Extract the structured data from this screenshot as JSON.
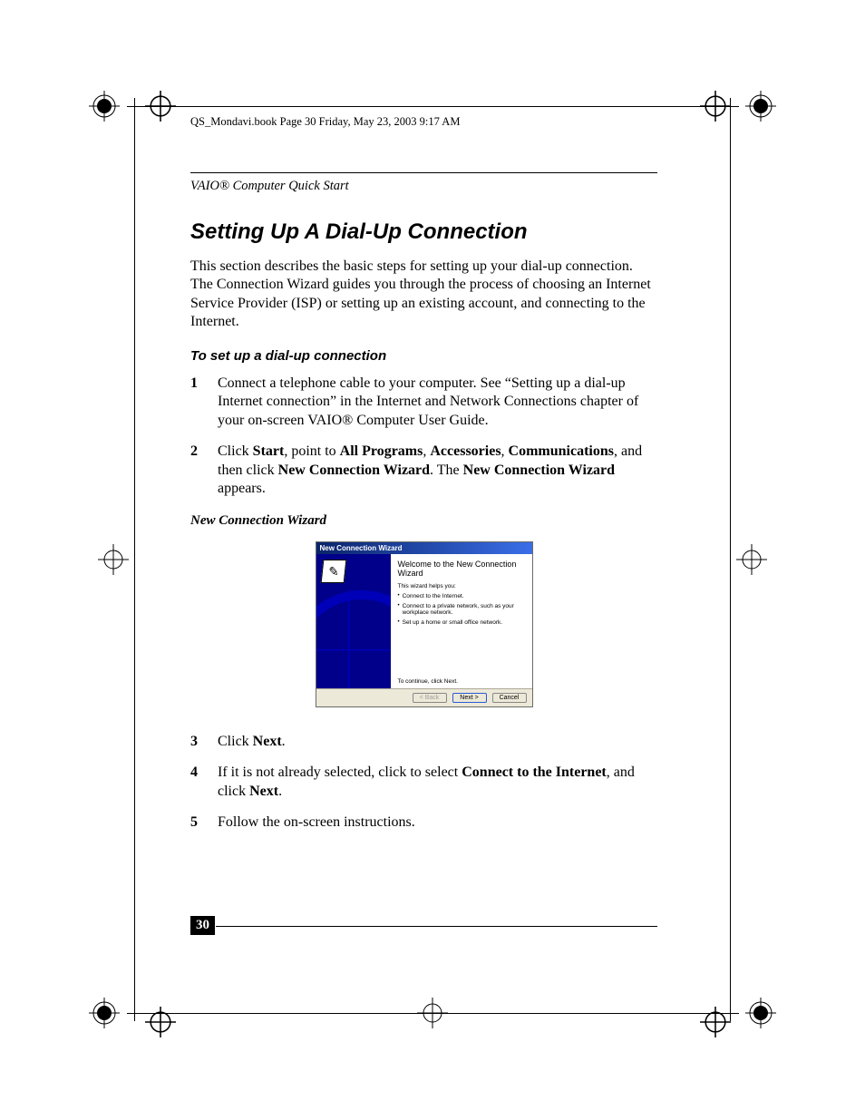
{
  "header_line": "QS_Mondavi.book  Page 30  Friday, May 23, 2003  9:17 AM",
  "running_head": "VAIO® Computer Quick Start",
  "section_title": "Setting Up A Dial-Up Connection",
  "intro_para": "This section describes the basic steps for setting up your dial-up connection. The Connection Wizard guides you through the process of choosing an Internet Service Provider (ISP) or setting up an existing account, and connecting to the Internet.",
  "sub_title": "To set up a dial-up connection",
  "steps": {
    "s1": {
      "num": "1",
      "text_a": "Connect a telephone cable to your computer. See “Setting up a dial-up Internet connection” in the Internet and Network Connections chapter of your on-screen VAIO® Computer User Guide."
    },
    "s2": {
      "num": "2",
      "t1": "Click ",
      "b1": "Start",
      "t2": ", point to ",
      "b2": "All Programs",
      "t3": ", ",
      "b3": "Accessories",
      "t4": ", ",
      "b4": "Communications",
      "t5": ", and then click ",
      "b5": "New Connection Wizard",
      "t6": ". The ",
      "b6": "New Connection Wizard",
      "t7": " appears."
    },
    "s3": {
      "num": "3",
      "t1": "Click ",
      "b1": "Next",
      "t2": "."
    },
    "s4": {
      "num": "4",
      "t1": "If it is not already selected, click to select ",
      "b1": "Connect to the Internet",
      "t2": ", and click ",
      "b2": "Next",
      "t3": "."
    },
    "s5": {
      "num": "5",
      "t1": "Follow the on-screen instructions."
    }
  },
  "fig_caption": "New Connection Wizard",
  "wizard": {
    "title": "New Connection Wizard",
    "welcome": "Welcome to the New Connection Wizard",
    "helps": "This wizard helps you:",
    "bul1": "Connect to the Internet.",
    "bul2": "Connect to a private network, such as your workplace network.",
    "bul3": "Set up a home or small office network.",
    "continue": "To continue, click Next.",
    "back": "< Back",
    "next": "Next >",
    "cancel": "Cancel"
  },
  "page_number": "30"
}
